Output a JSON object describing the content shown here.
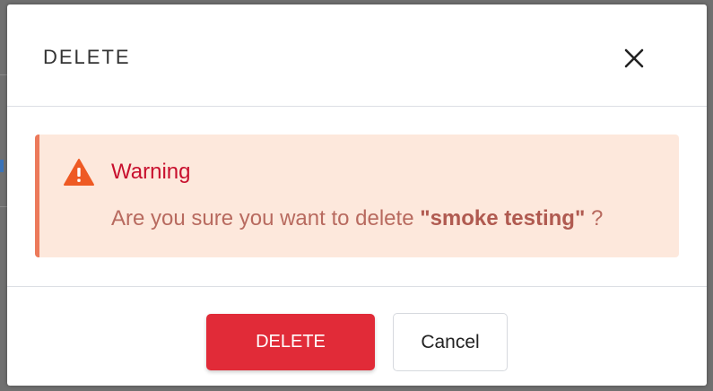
{
  "dialog": {
    "title": "DELETE",
    "close_icon": "close-icon"
  },
  "alert": {
    "icon": "warning-triangle-icon",
    "title": "Warning",
    "message_prefix": "Are you sure you want to delete ",
    "item_name": "\"smoke testing\"",
    "message_suffix": " ?",
    "colors": {
      "background": "#fde8dc",
      "border": "#ec7a5b",
      "title": "#c8102e",
      "text": "#b86a5f",
      "icon": "#ee5a24"
    }
  },
  "footer": {
    "delete_label": "DELETE",
    "cancel_label": "Cancel",
    "delete_color": "#e12b38"
  }
}
